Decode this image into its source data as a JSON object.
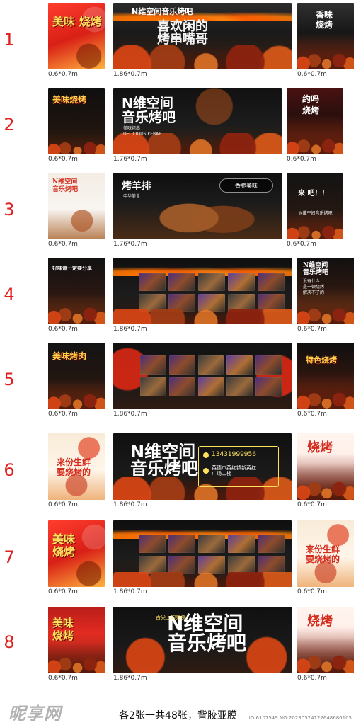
{
  "rows": [
    {
      "number": "1",
      "left": {
        "text_main": "美味\n烧烤",
        "label": "0.6*0.7m"
      },
      "center": {
        "title": "N维空间音乐烤吧",
        "subtitle": "喜欢闲的\n烤串嘴哥",
        "label": "1.86*0.7m"
      },
      "right": {
        "text_main": "香味\n烧烤",
        "label": "0.6*0.7m"
      }
    },
    {
      "number": "2",
      "left": {
        "text_main": "美味烧烤",
        "label": "0.6*0.7m"
      },
      "center": {
        "title": "N维空间\n音乐烤吧",
        "subtitle": "美味烤串\nDELICIOUS KEBAB",
        "label": "1.76*0.7m"
      },
      "right": {
        "text_main": "约吗\n烧烤",
        "label": "0.6*0.7m"
      }
    },
    {
      "number": "3",
      "left": {
        "text_main": "N维空间\n音乐烤吧",
        "label": "0.6*0.7m"
      },
      "center": {
        "title": "烤羊排",
        "subtitle": "中华美食",
        "tag": "香脆美味",
        "label": "1.76*0.7m"
      },
      "right": {
        "text_main": "来 吧！！",
        "subtext": "N维空间音乐烤吧",
        "label": "0.6*0.7m"
      }
    },
    {
      "number": "4",
      "left": {
        "text_main": "好味道一定要分享",
        "label": "0.6*0.7m"
      },
      "center": {
        "label": "1.86*0.7m"
      },
      "right": {
        "text_main": "N维空间\n音乐烤吧",
        "subtext": "没有什么\n是一顿烧烤\n解决不了的",
        "label": "0.6*0.7m"
      }
    },
    {
      "number": "5",
      "left": {
        "text_main": "美味烤肉",
        "label": "0.6*0.7m"
      },
      "center": {
        "label": "1.86*0.7m"
      },
      "right": {
        "text_main": "特色烧烤",
        "label": "0.6*0.7m"
      }
    },
    {
      "number": "6",
      "left": {
        "text_main": "来份生鲜\n要烧烤的",
        "label": "0.6*0.7m"
      },
      "center": {
        "title": "N维空间\n音乐烤吧",
        "phone": "13431999956",
        "address": "英德市英红镇新英红\n广场二楼",
        "label": "1.86*0.7m"
      },
      "right": {
        "text_main": "烧烤",
        "label": "0.6*0.7m"
      }
    },
    {
      "number": "7",
      "left": {
        "text_main": "美味\n烧烤",
        "label": "0.6*0.7m"
      },
      "center": {
        "label": "1.86*0.7m"
      },
      "right": {
        "text_main": "来份生鲜\n要烧烤的",
        "label": "0.6*0.7m"
      }
    },
    {
      "number": "8",
      "left": {
        "text_main": "美味\n烧烤",
        "label": "0.6*0.7m"
      },
      "center": {
        "title": "N维空间\n音乐烤吧",
        "subtitle": "舌尖上的美食",
        "label": "1.86*0.7m"
      },
      "right": {
        "text_main": "烧烤",
        "label": "0.6*0.7m"
      }
    }
  ],
  "footer": {
    "text": "各2张一共48张，背胶亚膜",
    "watermark_left": "昵享网",
    "watermark_right": "ID:6107549 NO:20230524122648686105"
  }
}
